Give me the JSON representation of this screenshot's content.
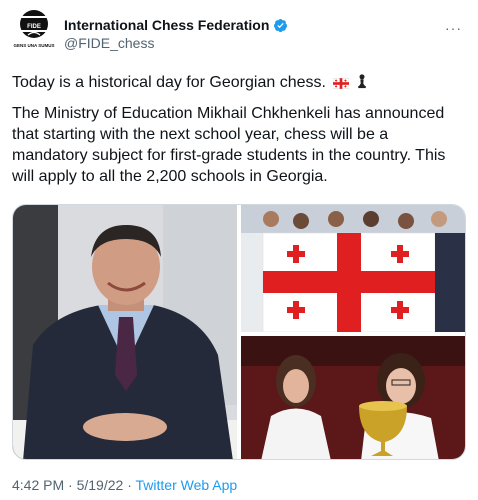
{
  "author": {
    "name": "International Chess Federation",
    "handle": "@FIDE_chess",
    "verified": true,
    "avatar_text": "FIDE",
    "avatar_motto": "GENS UNA SUMUS"
  },
  "more_icon": "more-options-icon",
  "tweet": {
    "line1": "Today is a historical day for Georgian chess.",
    "paragraph2": "The Ministry of Education Mikhail Chkhenkeli has announced that starting with the next school year, chess will be a mandatory subject for first-grade students in the country. This will apply to all the 2,200 schools in Georgia.",
    "emojis": [
      "georgia-flag-icon",
      "chess-pawn-icon"
    ]
  },
  "media": {
    "images": [
      "man-in-suit-photo",
      "team-with-georgian-flag-photo",
      "women-with-trophy-photo"
    ]
  },
  "meta": {
    "time": "4:42 PM",
    "separator1": " · ",
    "date": "5/19/22",
    "separator2": " · ",
    "app": "Twitter Web App"
  },
  "colors": {
    "link": "#1d9bf0",
    "secondary_text": "#536471",
    "flag_red": "#e02020"
  }
}
